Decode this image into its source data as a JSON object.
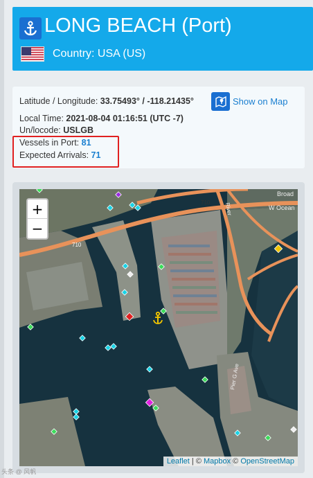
{
  "port": {
    "title": "LONG BEACH (Port)",
    "country": "Country: USA (US)"
  },
  "info": {
    "latlon_label": "Latitude / Longitude:",
    "latlon_value": "33.75493° / -118.21435°",
    "show_map_label": "Show on Map",
    "local_time_label": "Local Time:",
    "local_time_value": "2021-08-04 01:16:51 (UTC -7)",
    "unlocode_label": "Un/locode:",
    "unlocode_value": "USLGB",
    "vessels_label": "Vessels in Port:",
    "vessels_value": "81",
    "arrivals_label": "Expected Arrivals:",
    "arrivals_value": "71"
  },
  "map": {
    "zoom_in": "+",
    "zoom_out": "−",
    "road_labels": [
      "710",
      "710",
      "Pier G Ave",
      "W Ocean",
      "Broad",
      "River"
    ],
    "attribution": {
      "leaflet": "Leaflet",
      "sep": " | © ",
      "mapbox": "Mapbox",
      "sep2": " © ",
      "osm": "OpenStreetMap"
    }
  },
  "colors": {
    "header_bg": "#14a9ea",
    "link": "#1a7fd0",
    "highlight_border": "#e02020"
  },
  "watermark": "头条 @ 风帆"
}
